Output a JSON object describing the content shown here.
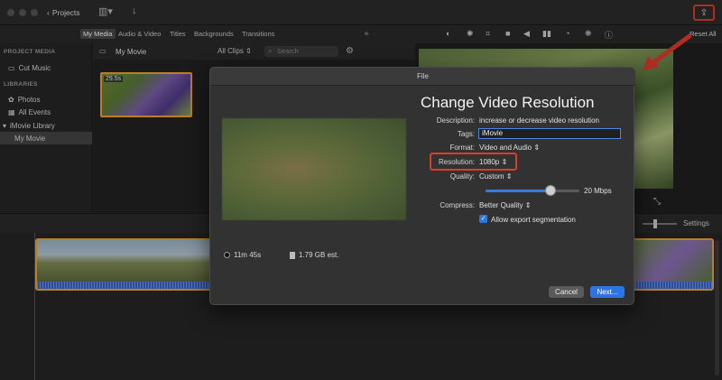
{
  "toolbar": {
    "projects_label": "Projects",
    "share_icon": "share-icon"
  },
  "media_tabs": [
    "My Media",
    "Audio & Video",
    "Titles",
    "Backgrounds",
    "Transitions"
  ],
  "viewer_controls": {
    "reset_all": "Reset All"
  },
  "sidebar": {
    "project_media_heading": "PROJECT MEDIA",
    "cut_music": "Cut Music",
    "libraries_heading": "LIBRARIES",
    "photos": "Photos",
    "all_events": "All Events",
    "imovie_library": "iMovie Library",
    "my_movie": "My Movie"
  },
  "browser": {
    "title": "My Movie",
    "filter": "All Clips",
    "search_placeholder": "Search",
    "clip_duration": "29.5s"
  },
  "timeline": {
    "settings_label": "Settings"
  },
  "dialog": {
    "title": "File",
    "heading": "Change Video Resolution",
    "description_label": "Description:",
    "description_value": "increase or decrease video resolution",
    "tags_label": "Tags:",
    "tags_value": "iMovie",
    "format_label": "Format:",
    "format_value": "Video and Audio",
    "resolution_label": "Resolution:",
    "resolution_value": "1080p",
    "quality_label": "Quality:",
    "quality_value": "Custom",
    "bitrate": "20 Mbps",
    "quality_slider_fraction": 0.69,
    "compress_label": "Compress:",
    "compress_value": "Better Quality",
    "segmentation_label": "Allow export segmentation",
    "segmentation_checked": true,
    "duration": "11m 45s",
    "size": "1.79 GB est.",
    "cancel": "Cancel",
    "next": "Next..."
  },
  "colors": {
    "accent_blue": "#2f74e6",
    "highlight_red": "#e03a2a",
    "clip_border": "#f0a22a"
  }
}
